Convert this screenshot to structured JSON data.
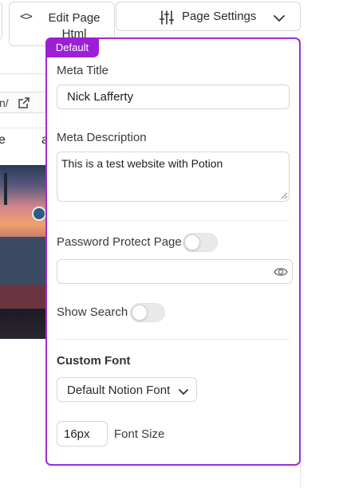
{
  "toolbar": {
    "edit_html_label": "Edit Page Html",
    "code_icon": "code-icon",
    "page_settings_label": "Page Settings",
    "sliders_icon": "sliders-icon",
    "chevron_icon": "chevron-down-icon"
  },
  "background": {
    "url_fragment": "n/",
    "nav_fragment_1": "e",
    "nav_fragment_2": "a"
  },
  "settings_panel": {
    "badge": "Default",
    "meta_title": {
      "label": "Meta Title",
      "value": "Nick Lafferty"
    },
    "meta_description": {
      "label": "Meta Description",
      "value": "This is a test website with Potion"
    },
    "password_protect": {
      "label": "Password Protect Page",
      "enabled": false,
      "value": ""
    },
    "show_search": {
      "label": "Show Search",
      "enabled": false
    },
    "custom_font": {
      "heading": "Custom Font",
      "selected": "Default Notion Font"
    },
    "font_size": {
      "value": "16px",
      "label": "Font Size"
    }
  },
  "colors": {
    "accent": "#9b2fd0",
    "badge_bg": "#9b1fd6"
  }
}
